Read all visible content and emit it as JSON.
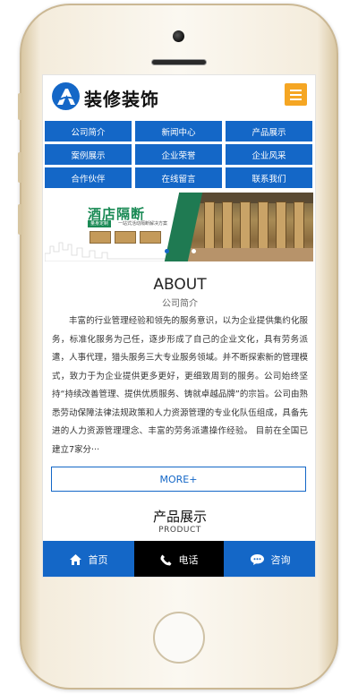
{
  "header": {
    "logo_letter": "A",
    "site_title": "装修装饰"
  },
  "nav": {
    "items": [
      {
        "label": "公司简介"
      },
      {
        "label": "新闻中心"
      },
      {
        "label": "产品展示"
      },
      {
        "label": "案例展示"
      },
      {
        "label": "企业荣誉"
      },
      {
        "label": "企业风采"
      },
      {
        "label": "合作伙伴"
      },
      {
        "label": "在线留言"
      },
      {
        "label": "联系我们"
      }
    ]
  },
  "banner": {
    "title": "酒店隔断",
    "tag": "量身定制",
    "subtitle": "一站式活动隔断解决方案",
    "slide_count": 2,
    "active_slide": 1
  },
  "about": {
    "title": "ABOUT",
    "subtitle": "公司简介",
    "body": "丰富的行业管理经验和领先的服务意识，以为企业提供集约化服务，标准化服务为己任，逐步形成了自己的企业文化，具有劳务派遣，人事代理，猎头服务三大专业服务领域。并不断探索新的管理模式，致力于为企业提供更多更好，更细致周到的服务。公司始终坚持“持续改善管理、提供优质服务、铸就卓越品牌”的宗旨。公司由熟悉劳动保障法律法规政策和人力资源管理的专业化队伍组成，具备先进的人力资源管理理念、丰富的劳务派遣操作经验。 目前在全国已建立7家分···",
    "more_label": "MORE+"
  },
  "products": {
    "title": "产品展示",
    "subtitle": "PRODUCT"
  },
  "bottom_bar": {
    "home_label": "首页",
    "phone_label": "电话",
    "chat_label": "咨询"
  },
  "colors": {
    "primary": "#1467c7",
    "menu_button": "#f5a623",
    "phone_bar": "#000000",
    "banner_green": "#1a8a55"
  },
  "icons": {
    "menu": "hamburger-menu-icon",
    "home": "home-icon",
    "phone": "phone-icon",
    "chat": "chat-bubble-icon"
  }
}
